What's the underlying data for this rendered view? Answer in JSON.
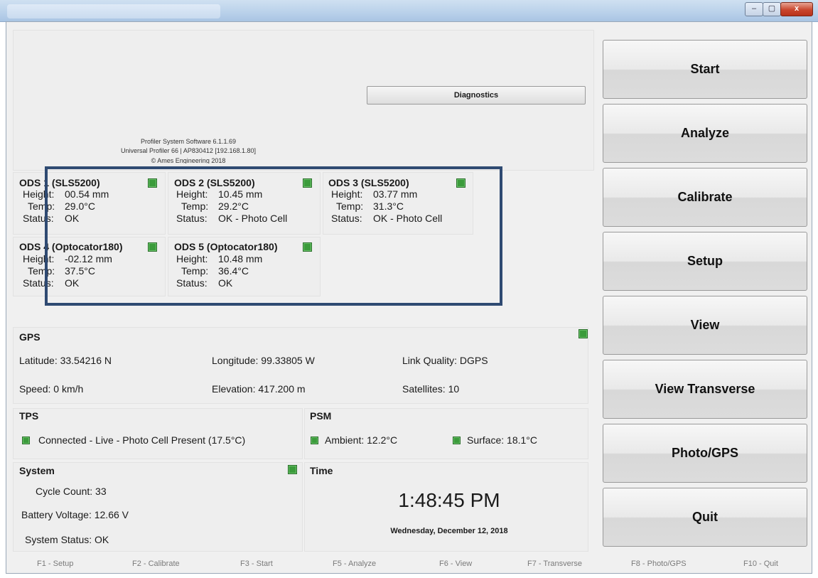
{
  "window": {
    "minimize": "–",
    "maximize": "▢",
    "close": "x"
  },
  "header": {
    "software": "Profiler System Software 6.1.1.69",
    "device": "Universal Profiler 66 | AP830412 [192.168.1.80]",
    "copyright": "© Ames Engineering 2018",
    "diagnostics": "Diagnostics"
  },
  "ods": [
    {
      "name": "ODS 1 (SLS5200)",
      "height_label": "Height:",
      "height": "00.54 mm",
      "temp_label": "Temp:",
      "temp": "29.0°C",
      "status_label": "Status:",
      "status": "OK",
      "led": "#3b9b3b"
    },
    {
      "name": "ODS 2 (SLS5200)",
      "height_label": "Height:",
      "height": "10.45 mm",
      "temp_label": "Temp:",
      "temp": "29.2°C",
      "status_label": "Status:",
      "status": "OK - Photo Cell",
      "led": "#3b9b3b"
    },
    {
      "name": "ODS 3 (SLS5200)",
      "height_label": "Height:",
      "height": "03.77 mm",
      "temp_label": "Temp:",
      "temp": "31.3°C",
      "status_label": "Status:",
      "status": "OK - Photo Cell",
      "led": "#3b9b3b"
    },
    {
      "name": "ODS 4 (Optocator180)",
      "height_label": "Height:",
      "height": "-02.12 mm",
      "temp_label": "Temp:",
      "temp": "37.5°C",
      "status_label": "Status:",
      "status": "OK",
      "led": "#3b9b3b"
    },
    {
      "name": "ODS 5 (Optocator180)",
      "height_label": "Height:",
      "height": "10.48 mm",
      "temp_label": "Temp:",
      "temp": "36.4°C",
      "status_label": "Status:",
      "status": "OK",
      "led": "#3b9b3b"
    }
  ],
  "gps": {
    "title": "GPS",
    "latitude": "Latitude: 33.54216 N",
    "longitude": "Longitude: 99.33805 W",
    "link_quality": "Link Quality: DGPS",
    "speed": "Speed: 0 km/h",
    "elevation": "Elevation: 417.200 m",
    "satellites": "Satellites: 10"
  },
  "tps": {
    "title": "TPS",
    "status": "Connected - Live  - Photo Cell Present (17.5°C)"
  },
  "psm": {
    "title": "PSM",
    "ambient": "Ambient: 12.2°C",
    "surface": "Surface: 18.1°C"
  },
  "system": {
    "title": "System",
    "cycle_count": "Cycle Count: 33",
    "battery_voltage": "Battery Voltage: 12.66 V",
    "status": "System Status: OK"
  },
  "time": {
    "title": "Time",
    "clock": "1:48:45 PM",
    "date": "Wednesday, December 12, 2018"
  },
  "side_buttons": [
    "Start",
    "Analyze",
    "Calibrate",
    "Setup",
    "View",
    "View Transverse",
    "Photo/GPS",
    "Quit"
  ],
  "function_keys": [
    "F1 - Setup",
    "F2 - Calibrate",
    "F3 - Start",
    "F5 - Analyze",
    "F6 - View",
    "F7 - Transverse",
    "F8 - Photo/GPS",
    "F10 - Quit"
  ],
  "colors": {
    "led_green": "#3b9b3b",
    "highlight_border": "#2f4a72"
  }
}
